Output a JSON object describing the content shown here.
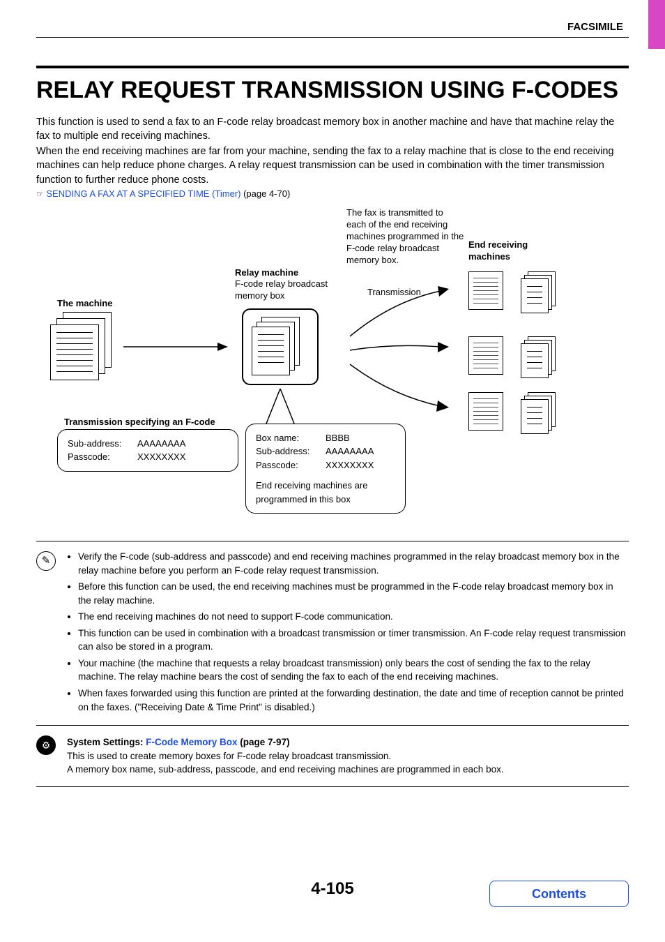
{
  "header": {
    "section": "FACSIMILE"
  },
  "title": "RELAY REQUEST TRANSMISSION USING F-CODES",
  "intro": {
    "p1": "This function is used to send a fax to an F-code relay broadcast memory box in another machine and have that machine relay the fax to multiple end receiving machines.",
    "p2": "When the end receiving machines are far from your machine, sending the fax to a relay machine that is close to the end receiving machines can help reduce phone charges. A relay request transmission can be used in combination with the timer transmission function to further reduce phone costs."
  },
  "reference": {
    "icon": "☞",
    "link_text": "SENDING A FAX AT A SPECIFIED TIME (Timer)",
    "page_ref": " (page 4-70)"
  },
  "diagram": {
    "machine_label": "The machine",
    "relay_label": "Relay machine",
    "relay_sub": "F-code relay broadcast memory box",
    "transmission_label": "Transmission",
    "broadcast_note": "The fax is transmitted to each of the end receiving machines programmed in the F-code relay broadcast memory box.",
    "end_label": "End receiving machines",
    "spec_label": "Transmission specifying an F-code",
    "box1": {
      "sub_addr_label": "Sub-address:",
      "sub_addr_val": "AAAAAAAA",
      "pass_label": "Passcode:",
      "pass_val": "XXXXXXXX"
    },
    "box2": {
      "name_label": "Box name:",
      "name_val": "BBBB",
      "sub_addr_label": "Sub-address:",
      "sub_addr_val": "AAAAAAAA",
      "pass_label": "Passcode:",
      "pass_val": "XXXXXXXX",
      "footer": "End receiving machines are programmed in this box"
    }
  },
  "notes": {
    "b1": "Verify the F-code (sub-address and passcode) and end receiving machines programmed in the relay broadcast memory box in the relay machine before you perform an F-code relay request transmission.",
    "b2": "Before this function can be used, the end receiving machines must be programmed in the F-code relay broadcast memory box in the relay machine.",
    "b3": "The end receiving machines do not need to support F-code communication.",
    "b4": "This function can be used in combination with a broadcast transmission or timer transmission. An F-code relay request transmission can also be stored in a program.",
    "b5": "Your machine (the machine that requests a relay broadcast transmission) only bears the cost of sending the fax to the relay machine. The relay machine bears the cost of sending the fax to each of the end receiving machines.",
    "b6": "When faxes forwarded using this function are printed at the forwarding destination, the date and time of reception cannot be printed on the faxes. (\"Receiving Date & Time Print\" is disabled.)"
  },
  "system": {
    "prefix": "System Settings:  ",
    "link": "F-Code Memory Box",
    "page_ref": " (page 7-97)",
    "line1": "This is used to create memory boxes for F-code relay broadcast transmission.",
    "line2": "A memory box name, sub-address, passcode, and end receiving machines are programmed in each box."
  },
  "footer": {
    "page_number": "4-105",
    "contents": "Contents"
  }
}
